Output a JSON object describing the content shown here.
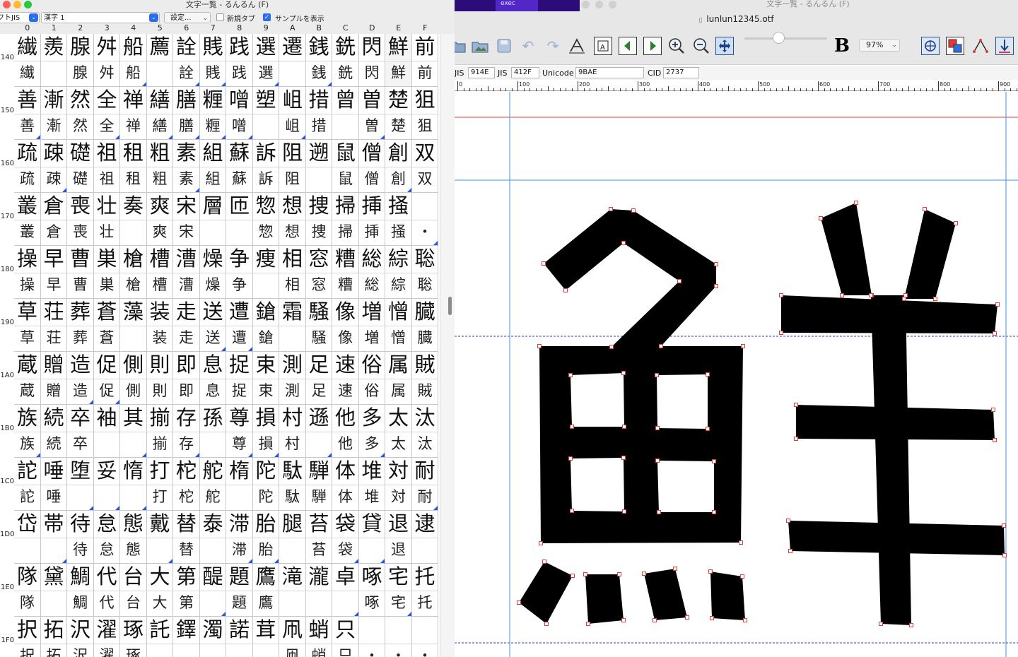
{
  "left_window": {
    "title": "文字一覧 - るんるん (F)",
    "encoding_select": "シフトJIS",
    "kanji_select": "漢字 1",
    "settings_label": "設定...",
    "new_tab_label": "新規タブ",
    "show_sample_label": "サンプルを表示",
    "show_sample_checked": true,
    "new_tab_checked": false,
    "col_headers": [
      "0",
      "1",
      "2",
      "3",
      "4",
      "5",
      "6",
      "7",
      "8",
      "9",
      "A",
      "B",
      "C",
      "D",
      "E",
      "F"
    ],
    "rows": [
      {
        "label": "140",
        "top": "繊羨腺舛船薦詮賎践選遷銭銑閃鮮前",
        "bottom": [
          "繊",
          "",
          "腺",
          "舛",
          "船",
          "",
          "詮",
          "賎",
          "践",
          "選",
          "",
          "銭",
          "銑",
          "閃",
          "鮮",
          "前"
        ]
      },
      {
        "label": "150",
        "top": "善漸然全禅繕膳糎噌塑岨措曾曽楚狙",
        "bottom": [
          "善",
          "漸",
          "然",
          "全",
          "禅",
          "繕",
          "膳",
          "糎",
          "噌",
          "",
          "岨",
          "措",
          "",
          "曽",
          "楚",
          "狙"
        ]
      },
      {
        "label": "160",
        "top": "疏疎礎祖租粗素組蘇訴阻遡鼠僧創双",
        "bottom": [
          "疏",
          "疎",
          "礎",
          "祖",
          "租",
          "粗",
          "素",
          "組",
          "蘇",
          "訴",
          "阻",
          "",
          "鼠",
          "僧",
          "創",
          "双"
        ]
      },
      {
        "label": "170",
        "top": "叢倉喪壮奏爽宋層匝惣想捜掃挿掻",
        "bottom": [
          "叢",
          "倉",
          "喪",
          "壮",
          "",
          "爽",
          "宋",
          "",
          "",
          "惣",
          "想",
          "捜",
          "掃",
          "挿",
          "掻",
          "・"
        ]
      },
      {
        "label": "180",
        "top": "操早曹巣槍槽漕燥争痩相窓糟総綜聡",
        "bottom": [
          "操",
          "早",
          "曹",
          "巣",
          "槍",
          "槽",
          "漕",
          "燥",
          "争",
          "",
          "相",
          "窓",
          "糟",
          "総",
          "綜",
          "聡"
        ]
      },
      {
        "label": "190",
        "top": "草荘葬蒼藻装走送遭鎗霜騒像増憎臓",
        "bottom": [
          "草",
          "荘",
          "葬",
          "蒼",
          "",
          "装",
          "走",
          "送",
          "遭",
          "鎗",
          "",
          "騒",
          "像",
          "増",
          "憎",
          "臓"
        ]
      },
      {
        "label": "1A0",
        "top": "蔵贈造促側則即息捉束測足速俗属賊",
        "bottom": [
          "蔵",
          "贈",
          "造",
          "促",
          "側",
          "則",
          "即",
          "息",
          "捉",
          "束",
          "測",
          "足",
          "速",
          "俗",
          "属",
          "賊"
        ]
      },
      {
        "label": "1B0",
        "top": "族続卒袖其揃存孫尊損村遜他多太汰",
        "bottom": [
          "族",
          "続",
          "卒",
          "",
          "",
          "揃",
          "存",
          "",
          "尊",
          "損",
          "村",
          "",
          "他",
          "多",
          "太",
          "汰"
        ]
      },
      {
        "label": "1C0",
        "top": "詑唾堕妥惰打柁舵楕陀駄騨体堆対耐",
        "bottom": [
          "詑",
          "唾",
          "",
          "",
          "",
          "打",
          "柁",
          "舵",
          "",
          "陀",
          "駄",
          "騨",
          "体",
          "堆",
          "対",
          "耐"
        ]
      },
      {
        "label": "1D0",
        "top": "岱帯待怠態戴替泰滞胎腿苔袋貸退逮",
        "bottom": [
          "",
          "",
          "待",
          "怠",
          "態",
          "",
          "替",
          "",
          "滞",
          "胎",
          "",
          "苔",
          "袋",
          "",
          "退",
          ""
        ]
      },
      {
        "label": "1E0",
        "top": "隊黛鯛代台大第醍題鷹滝瀧卓啄宅托",
        "bottom": [
          "隊",
          "",
          "鯛",
          "代",
          "台",
          "大",
          "第",
          "",
          "題",
          "鷹",
          "",
          "",
          "",
          "啄",
          "宅",
          "托"
        ]
      },
      {
        "label": "1F0",
        "top": "択拓沢濯琢託鐸濁諾茸凧蛸只",
        "bottom": [
          "択",
          "拓",
          "沢",
          "濯",
          "琢",
          "",
          "",
          "",
          "",
          "",
          "凧",
          "蛸",
          "只",
          "・",
          "・",
          "・"
        ]
      }
    ]
  },
  "right_window": {
    "top_title": "文字一覧 - るんるん (F)",
    "exec_label": "exec",
    "doc_title": "lunlun12345.otf",
    "zoom": "97%",
    "bold_label": "B",
    "jis_label_1": "JIS",
    "jis_value_1": "914E",
    "jis_label_2": "JIS",
    "jis_value_2": "412F",
    "unicode_label": "Unicode",
    "unicode_value": "9BAE",
    "cid_label": "CID",
    "cid_value": "2737",
    "ruler_ticks": [
      "0",
      "100",
      "200",
      "300",
      "400",
      "500",
      "600",
      "700",
      "800",
      "900"
    ],
    "glyph_char": "鮮",
    "colors": {
      "guide_blue": "#3f8fe0",
      "guide_red": "#e23b3b",
      "point_red": "#e23b3b",
      "select_blue": "#2a6ef0"
    }
  }
}
